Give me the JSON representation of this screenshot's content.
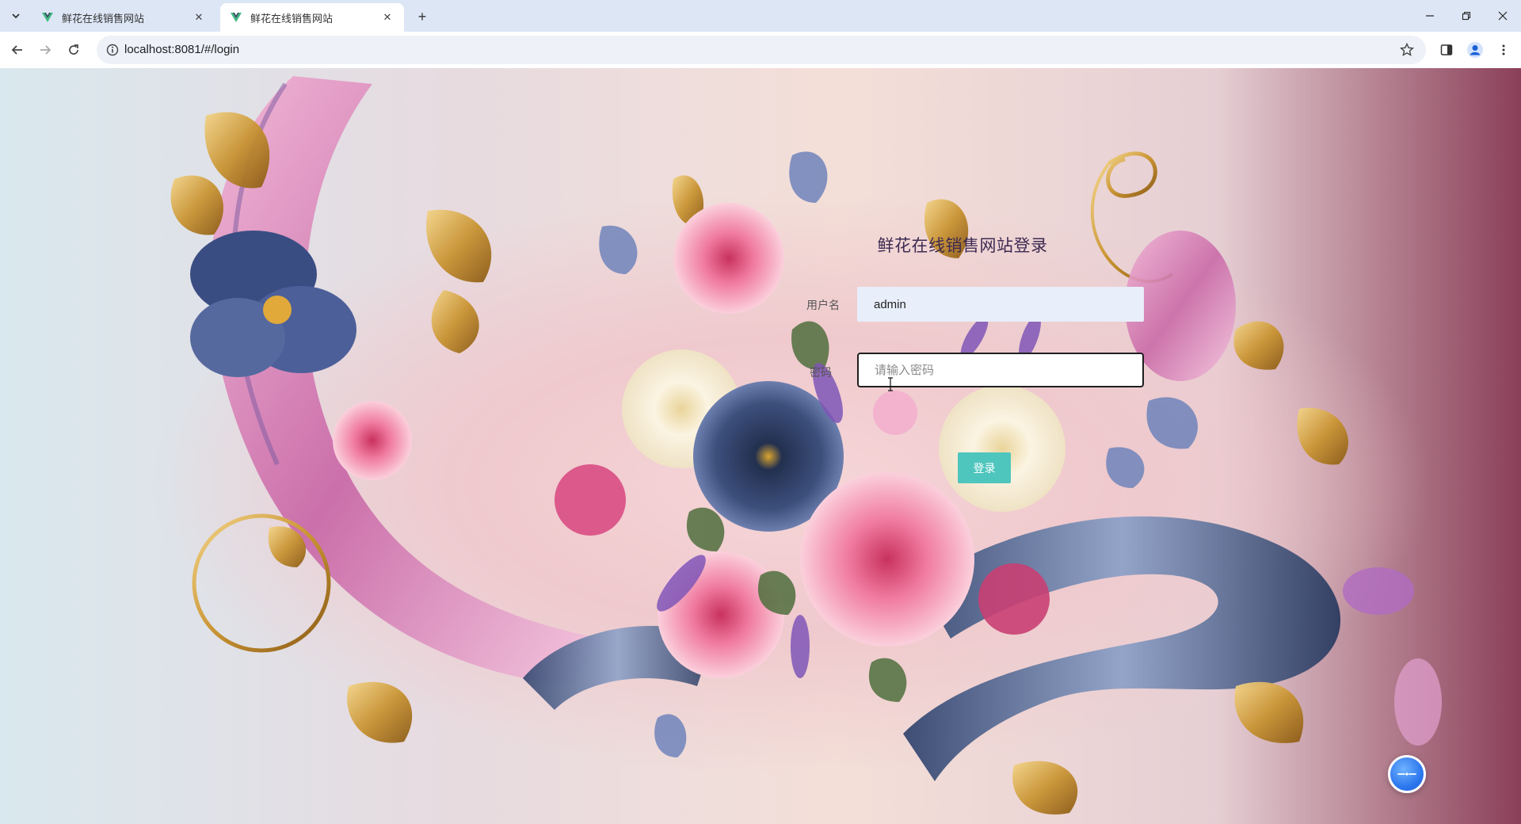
{
  "browser": {
    "tabs": [
      {
        "title": "鲜花在线销售网站",
        "active": false
      },
      {
        "title": "鲜花在线销售网站",
        "active": true
      }
    ],
    "url": "localhost:8081/#/login"
  },
  "login": {
    "title": "鲜花在线销售网站登录",
    "username_label": "用户名",
    "username_value": "admin",
    "password_label": "密码",
    "password_placeholder": "请输入密码",
    "submit_label": "登录"
  },
  "icons": {
    "favicon": "vue-logo-icon",
    "assistant": "chat-assistant-icon"
  },
  "colors": {
    "accent_button": "#4fc6bd",
    "title_text": "#3d2a52",
    "username_field_bg": "#e8eefa",
    "tab_strip": "#dde6f5"
  }
}
